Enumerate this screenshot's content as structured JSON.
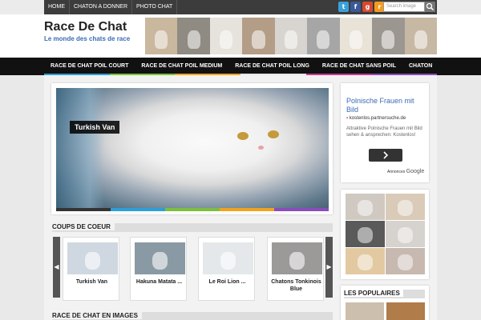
{
  "topnav": {
    "items": [
      "HOME",
      "CHATON A DONNER",
      "PHOTO CHAT"
    ]
  },
  "social": [
    {
      "icon": "twitter-icon",
      "glyph": "t",
      "color": "#3aa0d8"
    },
    {
      "icon": "facebook-icon",
      "glyph": "f",
      "color": "#3b5998"
    },
    {
      "icon": "google-plus-icon",
      "glyph": "g",
      "color": "#d6492f"
    },
    {
      "icon": "rss-icon",
      "glyph": "r",
      "color": "#f39b1f"
    }
  ],
  "search": {
    "placeholder": "Search image"
  },
  "header": {
    "title": "Race De Chat",
    "subtitle": "Le monde des chats de race",
    "banner_colors": [
      "#c9b79e",
      "#8f8a82",
      "#e6e2dc",
      "#b39d86",
      "#d8d4cf",
      "#a6a6a6",
      "#e9e3d7",
      "#9c9690",
      "#c7b8a4"
    ]
  },
  "mainnav": {
    "items": [
      "RACE DE CHAT POIL COURT",
      "RACE DE CHAT POIL MEDIUM",
      "RACE DE CHAT POIL LONG",
      "RACE DE CHAT SANS POIL",
      "CHATON"
    ]
  },
  "colors": {
    "strip": [
      "#2b9fd9",
      "#7bbf3c",
      "#f2a21c",
      "#e6e6e6",
      "#c43b8e",
      "#8b4bbd"
    ],
    "slide_bar": [
      "#333333",
      "#2b9fd9",
      "#7bbf3c",
      "#f2a21c",
      "#8b4bbd"
    ],
    "link_blue": "#3a6bb4"
  },
  "slider": {
    "caption": "Turkish Van"
  },
  "coups": {
    "heading": "COUPS DE COEUR",
    "items": [
      {
        "title": "Turkish Van",
        "tone": "#cfd8e0"
      },
      {
        "title": "Hakuna Matata ...",
        "tone": "#8a9aa4"
      },
      {
        "title": "Le Roi Lion ...",
        "tone": "#e4e8ea"
      },
      {
        "title": "Chatons Tonkinois Blue",
        "tone": "#9c9a98"
      }
    ]
  },
  "images_section": {
    "heading": "RACE DE CHAT EN IMAGES"
  },
  "ad": {
    "title": "Polnische Frauen mit Bild",
    "url": "kostenlos.partnersuche.de",
    "description": "Attraktive Polnische Frauen mit Bild sehen & ansprechen: Kostenlos!",
    "footer_label": "Annonces",
    "footer_brand": "Google",
    "button_icon": "chevron-right-icon"
  },
  "collage": {
    "tones": [
      "#cfc9c2",
      "#d9cbb8",
      "#5a5a5a",
      "#d6d2cd",
      "#e2c9a2",
      "#c7b9b0"
    ]
  },
  "populaires": {
    "heading": "LES POPULAIRES",
    "tones": [
      "#cdbfae",
      "#b07c4a"
    ]
  }
}
